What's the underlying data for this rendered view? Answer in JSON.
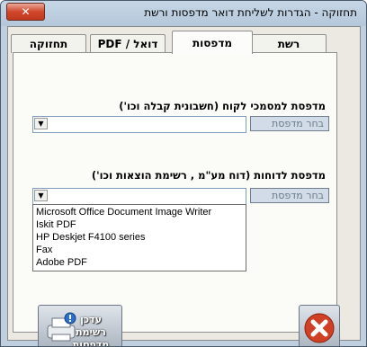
{
  "window": {
    "title": "תחזוקה - הגדרות לשליחת דואר מדפסות ורשת",
    "close_glyph": "✕"
  },
  "tabs": [
    {
      "label": "רשת"
    },
    {
      "label": "מדפסות"
    },
    {
      "label": "דואל / PDF"
    },
    {
      "label": "תחזוקה"
    }
  ],
  "printers": {
    "client_docs_label": "מדפסת למסמכי לקוח (חשבונית קבלה וכו')",
    "client_select_label": "בחר מדפסת",
    "client_combo_value": "",
    "reports_label": "מדפסת לדוחות (דוח מע\"מ , רשימת הוצאות וכו')",
    "reports_select_label": "בחר מדפסת",
    "reports_combo_value": "",
    "options": [
      "Microsoft Office Document Image Writer",
      "Iskit PDF",
      "HP Deskjet F4100 series",
      "Fax",
      "Adobe PDF"
    ]
  },
  "buttons": {
    "update_list_label": "עדכן רשימת מדפסות"
  },
  "colors": {
    "titlebar": "#bfcfdf",
    "close_button": "#d0472c",
    "exit_icon": "#d04024"
  }
}
